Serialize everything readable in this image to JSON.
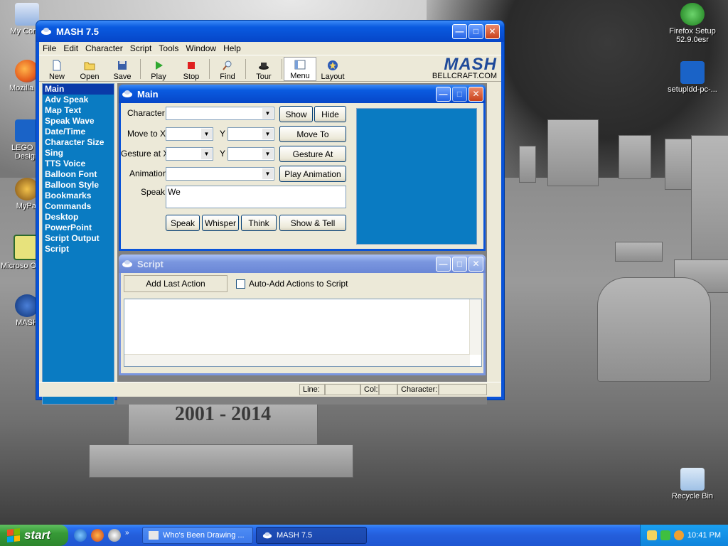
{
  "desktop": {
    "icons": [
      {
        "label": "My Comp",
        "name": "my-computer-icon"
      },
      {
        "label": "Mozilla Fir",
        "name": "firefox-icon"
      },
      {
        "label": "LEGO Di Design",
        "name": "lego-designer-icon"
      },
      {
        "label": "MyPal",
        "name": "mypal-icon"
      },
      {
        "label": "Microso Outloo",
        "name": "outlook-icon"
      },
      {
        "label": "MASH",
        "name": "mash-icon"
      },
      {
        "label": "Firefox Setup 52.9.0esr",
        "name": "firefox-setup-icon"
      },
      {
        "label": "setupldd-pc-...",
        "name": "lego-setup-icon"
      },
      {
        "label": "Recycle Bin",
        "name": "recycle-bin-icon"
      }
    ],
    "tombstone_text": "2001 - 2014"
  },
  "window": {
    "title": "MASH 7.5",
    "menu": [
      "File",
      "Edit",
      "Character",
      "Script",
      "Tools",
      "Window",
      "Help"
    ],
    "toolbar": [
      "New",
      "Open",
      "Save",
      "Play",
      "Stop",
      "Find",
      "Tour",
      "Menu",
      "Layout"
    ],
    "logo_text": "MASH",
    "logo_sub": "BELLCRAFT.COM",
    "sidebar": [
      "Main",
      "Adv Speak",
      "Map Text",
      "Speak Wave",
      "Date/Time",
      "Character Size",
      "Sing",
      "TTS Voice",
      "Balloon Font",
      "Balloon Style",
      "Bookmarks",
      "Commands",
      "Desktop",
      "PowerPoint",
      "Script Output",
      "Script"
    ],
    "status": {
      "line": "Line:",
      "col": "Col:",
      "character": "Character:"
    }
  },
  "main_panel": {
    "title": "Main",
    "labels": {
      "character": "Character",
      "move_to_x": "Move to X",
      "y1": "Y",
      "gesture_at_x": "Gesture at X",
      "y2": "Y",
      "animation": "Animation",
      "speak": "Speak"
    },
    "speak_value": "We",
    "buttons": {
      "show": "Show",
      "hide": "Hide",
      "move_to": "Move To",
      "gesture_at": "Gesture At",
      "play_animation": "Play Animation",
      "speak": "Speak",
      "whisper": "Whisper",
      "think": "Think",
      "show_tell": "Show & Tell"
    }
  },
  "script_panel": {
    "title": "Script",
    "add_last_action": "Add Last Action",
    "auto_add": "Auto-Add Actions to Script"
  },
  "taskbar": {
    "start": "start",
    "tasks": [
      "Who's Been Drawing ...",
      "MASH 7.5"
    ],
    "clock": "10:41 PM"
  },
  "colors": {
    "accent": "#0a53d8",
    "sidebar_bg": "#0a7bc2",
    "face": "#ece9d8"
  }
}
